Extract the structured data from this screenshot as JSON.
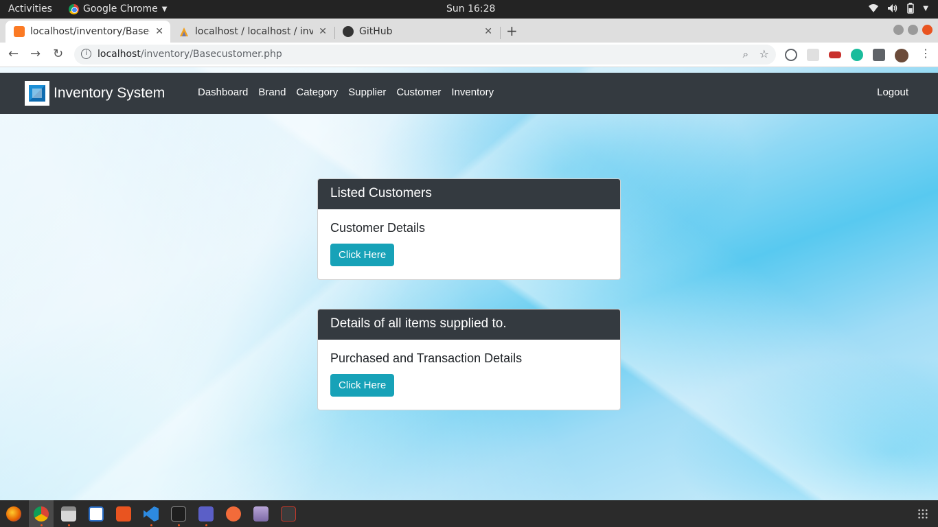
{
  "system": {
    "activities": "Activities",
    "app_name": "Google Chrome",
    "clock": "Sun 16:28"
  },
  "tabs": [
    {
      "title": "localhost/inventory/Basecustomer.php",
      "active": true
    },
    {
      "title": "localhost / localhost / inventory",
      "active": false
    },
    {
      "title": "GitHub",
      "active": false
    }
  ],
  "toolbar": {
    "url_host": "localhost",
    "url_path": "/inventory/Basecustomer.php"
  },
  "app": {
    "brand": "Inventory System",
    "nav": [
      "Dashboard",
      "Brand",
      "Category",
      "Supplier",
      "Customer",
      "Inventory"
    ],
    "logout": "Logout"
  },
  "cards": [
    {
      "header": "Listed Customers",
      "title": "Customer Details",
      "button": "Click Here"
    },
    {
      "header": "Details of all items supplied to.",
      "title": "Purchased and Transaction Details",
      "button": "Click Here"
    }
  ],
  "colors": {
    "navbar": "#343a40",
    "button": "#17a2b8",
    "ubuntu_accent": "#e95420"
  }
}
